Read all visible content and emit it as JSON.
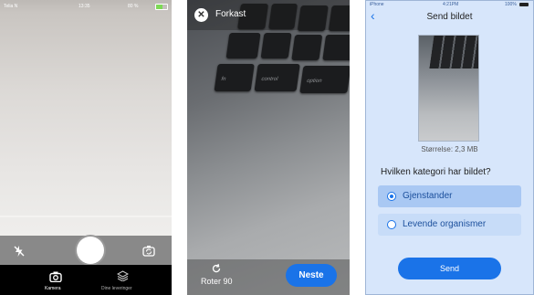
{
  "camera_screen": {
    "status": {
      "carrier": "Telia N",
      "time": "13:35",
      "battery": "80 %"
    },
    "icons": {
      "flash": "flash-off-icon",
      "switch_camera": "switch-camera-icon"
    },
    "tabs": [
      {
        "label": "Kamera",
        "icon": "camera-icon",
        "active": true
      },
      {
        "label": "Dine leveringer",
        "icon": "layers-icon",
        "active": false
      }
    ]
  },
  "review_screen": {
    "discard_label": "Forkast",
    "rotate_label": "Roter 90",
    "next_label": "Neste",
    "keyboard_keys": [
      "fn",
      "control",
      "option"
    ]
  },
  "send_screen": {
    "status": {
      "carrier": "iPhone",
      "time": "4:21PM",
      "battery": "100%"
    },
    "title": "Send bildet",
    "size_text": "Størrelse: 2,3 MB",
    "question": "Hvilken kategori har bildet?",
    "options": [
      {
        "label": "Gjenstander",
        "selected": true
      },
      {
        "label": "Levende organismer",
        "selected": false
      }
    ],
    "send_label": "Send",
    "accent_color": "#1a73e8"
  }
}
